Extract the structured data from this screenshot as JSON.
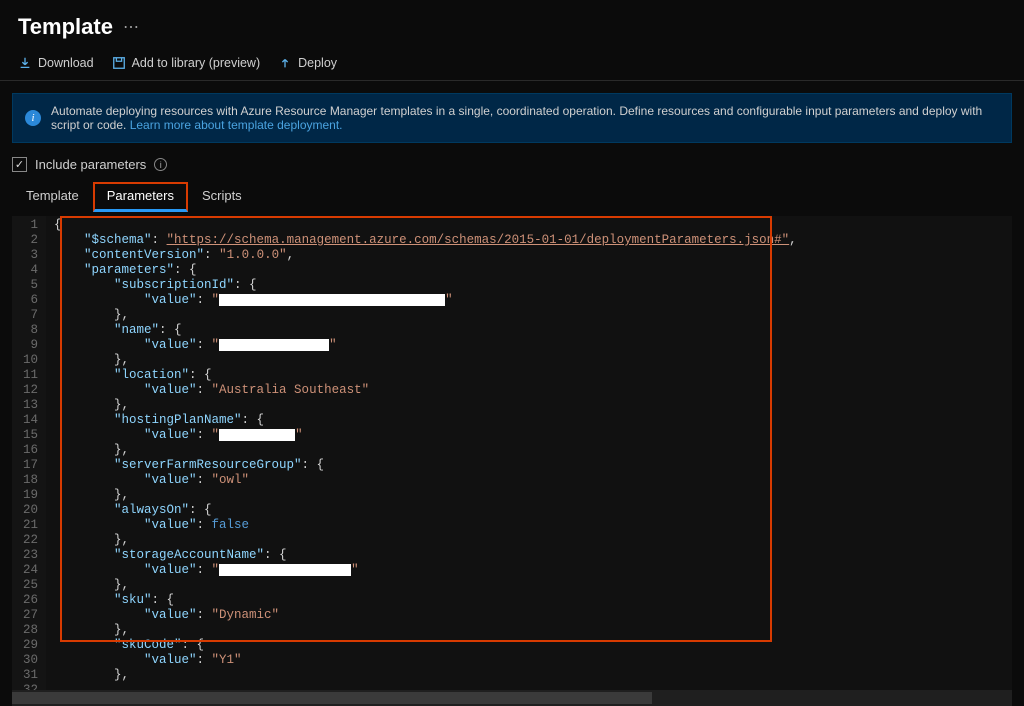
{
  "header": {
    "title": "Template",
    "more": "⋯"
  },
  "toolbar": {
    "download": "Download",
    "add_library": "Add to library (preview)",
    "deploy": "Deploy"
  },
  "banner": {
    "text": "Automate deploying resources with Azure Resource Manager templates in a single, coordinated operation. Define resources and configurable input parameters and deploy with script or code. ",
    "link_text": "Learn more about template deployment."
  },
  "include_params": {
    "label": "Include parameters",
    "checked": true
  },
  "tabs": [
    {
      "id": "template",
      "label": "Template",
      "active": false
    },
    {
      "id": "parameters",
      "label": "Parameters",
      "active": true
    },
    {
      "id": "scripts",
      "label": "Scripts",
      "active": false
    }
  ],
  "code": {
    "schema_url": "https://schema.management.azure.com/schemas/2015-01-01/deploymentParameters.json#",
    "contentVersion": "1.0.0.0",
    "parameters": {
      "subscriptionId": {
        "value_redacted": true,
        "value": "",
        "redact_w": 226
      },
      "name": {
        "value_redacted": true,
        "value": "",
        "redact_w": 110
      },
      "location": {
        "value_redacted": false,
        "value": "Australia Southeast"
      },
      "hostingPlanName": {
        "value_redacted": true,
        "value": "",
        "redact_w": 76
      },
      "serverFarmResourceGroup": {
        "value_redacted": false,
        "value": "owl"
      },
      "alwaysOn": {
        "value_redacted": false,
        "value": false
      },
      "storageAccountName": {
        "value_redacted": true,
        "value": "",
        "redact_w": 132
      },
      "sku": {
        "value_redacted": false,
        "value": "Dynamic"
      },
      "skuCode": {
        "value_redacted": false,
        "value": "Y1"
      }
    },
    "line_count": 32
  }
}
